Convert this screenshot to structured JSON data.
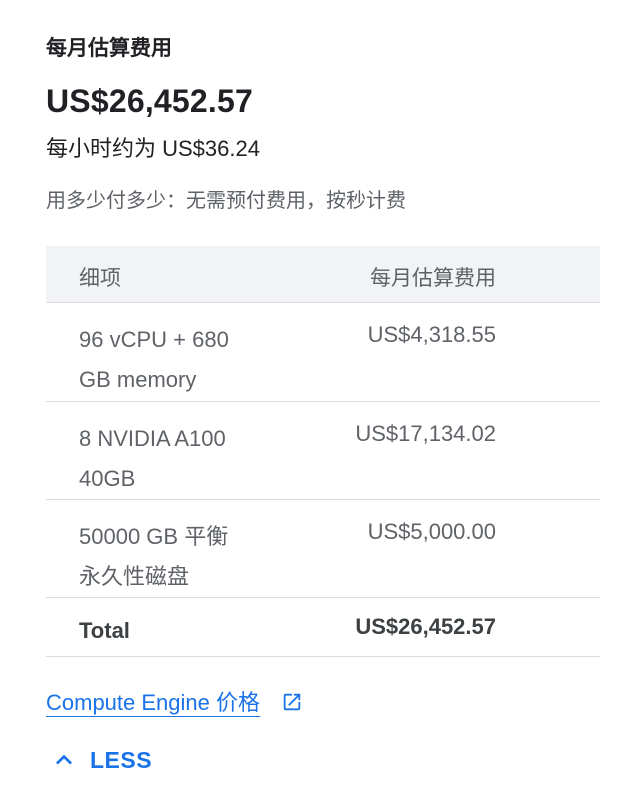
{
  "summary": {
    "title": "每月估算费用",
    "monthly_total": "US$26,452.57",
    "hourly": "每小时约为 US$36.24",
    "note": "用多少付多少：无需预付费用，按秒计费"
  },
  "table": {
    "headers": {
      "item": "细项",
      "cost": "每月估算费用"
    },
    "rows": [
      {
        "item_line1": "96 vCPU + 680",
        "item_line2": "GB memory",
        "cost": "US$4,318.55"
      },
      {
        "item_line1": "8 NVIDIA A100",
        "item_line2": "40GB",
        "cost": "US$17,134.02"
      },
      {
        "item_line1": "50000 GB 平衡",
        "item_line2": "永久性磁盘",
        "cost": "US$5,000.00"
      }
    ],
    "total": {
      "label": "Total",
      "cost": "US$26,452.57"
    }
  },
  "links": {
    "pricing": "Compute Engine 价格",
    "pricing_icon": "external-link-icon"
  },
  "toggle": {
    "label": "LESS",
    "icon": "chevron-up-icon"
  },
  "colors": {
    "accent": "#1a73e8",
    "header_bg": "#f1f3f4",
    "divider": "#dadce0",
    "secondary_text": "#5f6368"
  }
}
